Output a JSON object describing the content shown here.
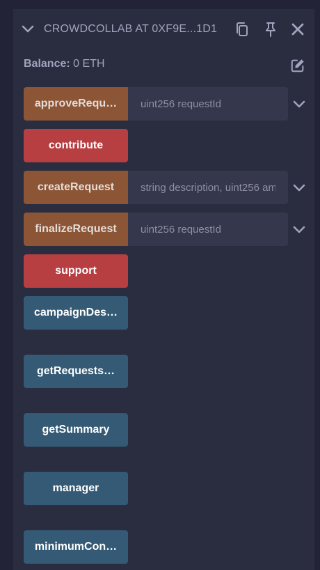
{
  "header": {
    "title": "CROWDCOLLAB AT 0XF9E...1D1",
    "icons": [
      "chevron-down-icon",
      "copy-icon",
      "pin-icon",
      "close-icon"
    ]
  },
  "balance": {
    "label": "Balance:",
    "value": "0 ETH"
  },
  "functions": [
    {
      "label": "approveRequ…",
      "color": "orange",
      "placeholder": "uint256 requestId",
      "has_input": true
    },
    {
      "label": "contribute",
      "color": "red",
      "has_input": false
    },
    {
      "label": "createRequest",
      "color": "orange",
      "placeholder": "string description, uint256 am",
      "has_input": true
    },
    {
      "label": "finalizeRequest",
      "color": "orange",
      "placeholder": "uint256 requestId",
      "has_input": true
    },
    {
      "label": "support",
      "color": "red",
      "has_input": false
    },
    {
      "label": "campaignDes…",
      "color": "blue",
      "has_input": false
    },
    {
      "label": "getRequests…",
      "color": "blue",
      "has_input": false
    },
    {
      "label": "getSummary",
      "color": "blue",
      "has_input": false
    },
    {
      "label": "manager",
      "color": "blue",
      "has_input": false
    },
    {
      "label": "minimumCon…",
      "color": "blue",
      "has_input": false
    }
  ],
  "colors": {
    "orange": "#8b5536",
    "red": "#b73f41",
    "blue": "#355a75",
    "panel": "#2a2c3f",
    "background": "#222336"
  }
}
